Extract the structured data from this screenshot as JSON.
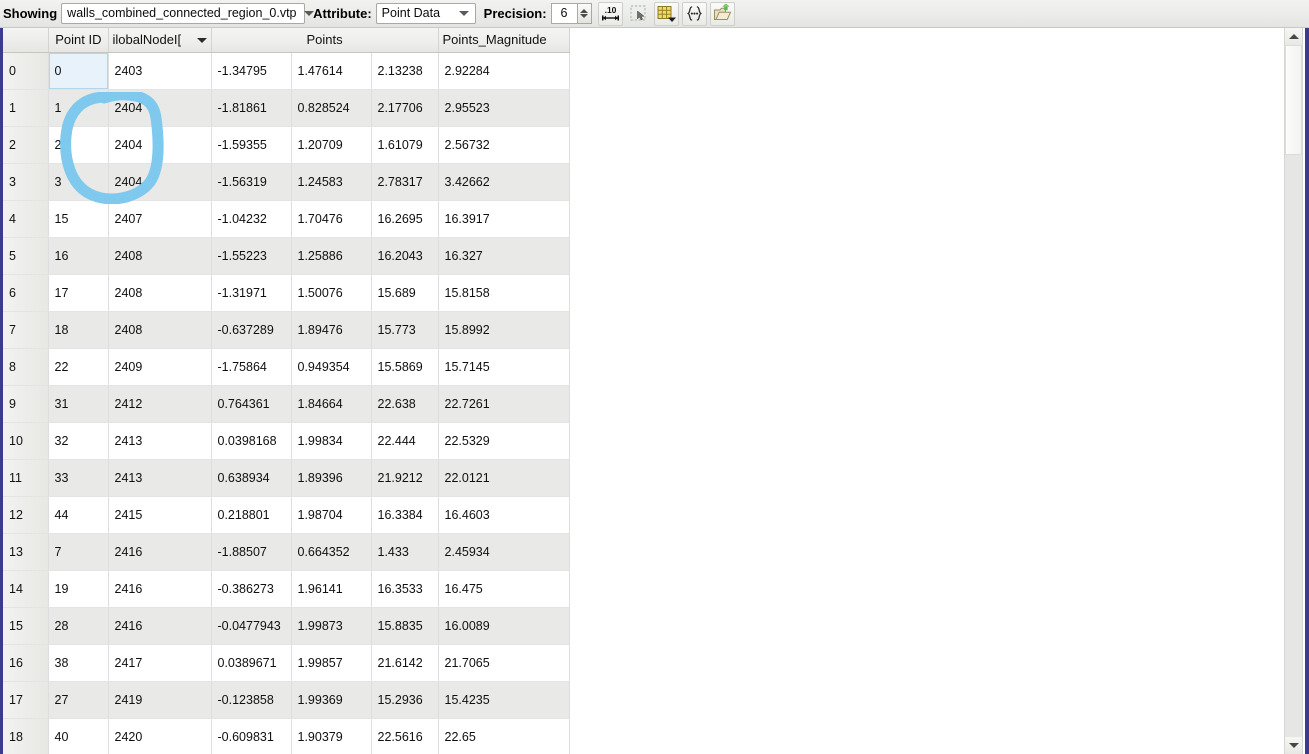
{
  "toolbar": {
    "showing_label": "Showing",
    "source_value": "walls_combined_connected_region_0.vtp",
    "attribute_label": "Attribute:",
    "attribute_value": "Point Data",
    "precision_label": "Precision:",
    "precision_value": "6",
    "buttons": [
      {
        "name": "toggle-column-visibility-precision-icon",
        "glyph": ".10"
      },
      {
        "name": "select-points-icon",
        "glyph": ""
      },
      {
        "name": "toggle-column-visibility-icon",
        "glyph": ""
      },
      {
        "name": "show-only-selected-elements-icon",
        "glyph": "{...}"
      },
      {
        "name": "export-spreadsheet-icon",
        "glyph": ""
      }
    ]
  },
  "table": {
    "headers": {
      "index": "",
      "point_id": "Point ID",
      "global_node_id": "ilobalNodeI[",
      "points": "Points",
      "points_magnitude": "Points_Magnitude"
    },
    "rows": [
      {
        "idx": "0",
        "pid": "0",
        "gnid": "2403",
        "px": "-1.34795",
        "py": "1.47614",
        "pz": "2.13238",
        "mag": "2.92284"
      },
      {
        "idx": "1",
        "pid": "1",
        "gnid": "2404",
        "px": "-1.81861",
        "py": "0.828524",
        "pz": "2.17706",
        "mag": "2.95523"
      },
      {
        "idx": "2",
        "pid": "2",
        "gnid": "2404",
        "px": "-1.59355",
        "py": "1.20709",
        "pz": "1.61079",
        "mag": "2.56732"
      },
      {
        "idx": "3",
        "pid": "3",
        "gnid": "2404",
        "px": "-1.56319",
        "py": "1.24583",
        "pz": "2.78317",
        "mag": "3.42662"
      },
      {
        "idx": "4",
        "pid": "15",
        "gnid": "2407",
        "px": "-1.04232",
        "py": "1.70476",
        "pz": "16.2695",
        "mag": "16.3917"
      },
      {
        "idx": "5",
        "pid": "16",
        "gnid": "2408",
        "px": "-1.55223",
        "py": "1.25886",
        "pz": "16.2043",
        "mag": "16.327"
      },
      {
        "idx": "6",
        "pid": "17",
        "gnid": "2408",
        "px": "-1.31971",
        "py": "1.50076",
        "pz": "15.689",
        "mag": "15.8158"
      },
      {
        "idx": "7",
        "pid": "18",
        "gnid": "2408",
        "px": "-0.637289",
        "py": "1.89476",
        "pz": "15.773",
        "mag": "15.8992"
      },
      {
        "idx": "8",
        "pid": "22",
        "gnid": "2409",
        "px": "-1.75864",
        "py": "0.949354",
        "pz": "15.5869",
        "mag": "15.7145"
      },
      {
        "idx": "9",
        "pid": "31",
        "gnid": "2412",
        "px": "0.764361",
        "py": "1.84664",
        "pz": "22.638",
        "mag": "22.7261"
      },
      {
        "idx": "10",
        "pid": "32",
        "gnid": "2413",
        "px": "0.0398168",
        "py": "1.99834",
        "pz": "22.444",
        "mag": "22.5329"
      },
      {
        "idx": "11",
        "pid": "33",
        "gnid": "2413",
        "px": "0.638934",
        "py": "1.89396",
        "pz": "21.9212",
        "mag": "22.0121"
      },
      {
        "idx": "12",
        "pid": "44",
        "gnid": "2415",
        "px": "0.218801",
        "py": "1.98704",
        "pz": "16.3384",
        "mag": "16.4603"
      },
      {
        "idx": "13",
        "pid": "7",
        "gnid": "2416",
        "px": "-1.88507",
        "py": "0.664352",
        "pz": "1.433",
        "mag": "2.45934"
      },
      {
        "idx": "14",
        "pid": "19",
        "gnid": "2416",
        "px": "-0.386273",
        "py": "1.96141",
        "pz": "16.3533",
        "mag": "16.475"
      },
      {
        "idx": "15",
        "pid": "28",
        "gnid": "2416",
        "px": "-0.0477943",
        "py": "1.99873",
        "pz": "15.8835",
        "mag": "16.0089"
      },
      {
        "idx": "16",
        "pid": "38",
        "gnid": "2417",
        "px": "0.0389671",
        "py": "1.99857",
        "pz": "21.6142",
        "mag": "21.7065"
      },
      {
        "idx": "17",
        "pid": "27",
        "gnid": "2419",
        "px": "-0.123858",
        "py": "1.99369",
        "pz": "15.2936",
        "mag": "15.4235"
      },
      {
        "idx": "18",
        "pid": "40",
        "gnid": "2420",
        "px": "-0.609831",
        "py": "1.90379",
        "pz": "22.5616",
        "mag": "22.65"
      }
    ]
  },
  "annotation": {
    "shape": "hand-drawn-ellipse",
    "color": "#7ec9ed"
  },
  "scrollbar": {
    "up_glyph": "▲",
    "down_glyph": "▼"
  }
}
